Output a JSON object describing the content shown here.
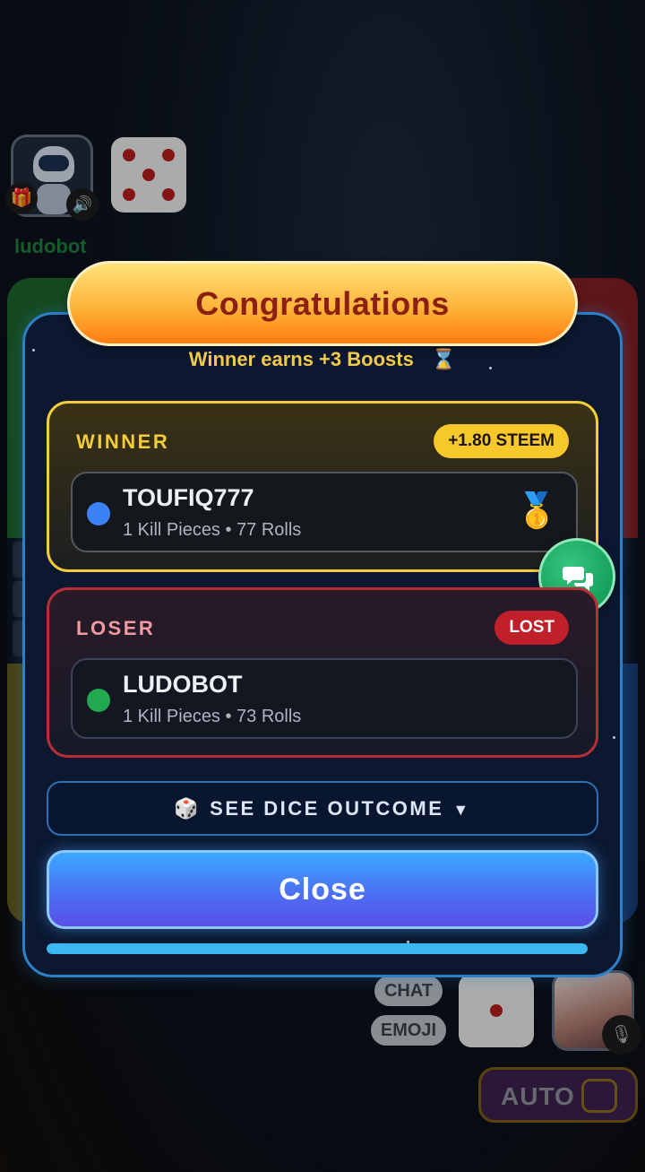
{
  "top_player": {
    "name": "ludobot"
  },
  "banner": {
    "title": "Congratulations"
  },
  "boost": {
    "text": "Winner earns +3 Boosts",
    "icon": "hourglass-icon"
  },
  "winner": {
    "title": "WINNER",
    "badge": "+1.80 STEEM",
    "player_name": "TOUFIQ777",
    "stats": "1 Kill Pieces • 77 Rolls",
    "dot_color": "#3b82f6",
    "medal": "🥇"
  },
  "loser": {
    "title": "LOSER",
    "badge": "LOST",
    "player_name": "LUDOBOT",
    "stats": "1 Kill Pieces • 73 Rolls",
    "dot_color": "#22a84e"
  },
  "dice_outcome": {
    "icon": "🎲",
    "label": "SEE DICE OUTCOME",
    "caret": "▼"
  },
  "close_button": {
    "label": "Close"
  },
  "progress": {
    "fraction": 1.0
  },
  "bottom_controls": {
    "chat_label": "CHAT",
    "emoji_label": "EMOJI",
    "auto_label": "AUTO"
  },
  "colors": {
    "winner_accent": "#f3cc3a",
    "loser_accent": "#b82e38",
    "modal_border": "#2d7fc8"
  }
}
